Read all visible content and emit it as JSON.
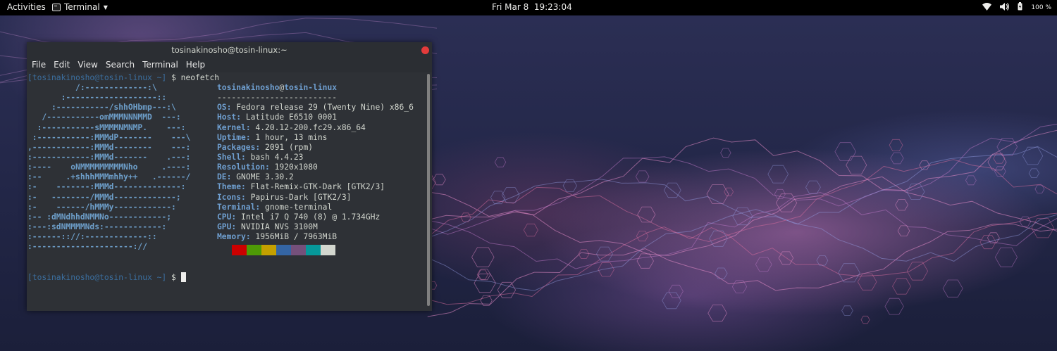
{
  "topbar": {
    "activities": "Activities",
    "app_name": "Terminal",
    "clock": "Fri Mar 8  19:23:04",
    "battery": "100 %"
  },
  "window": {
    "title": "tosinakinosho@tosin-linux:~",
    "menu": [
      "File",
      "Edit",
      "View",
      "Search",
      "Terminal",
      "Help"
    ]
  },
  "terminal": {
    "prompt": "[tosinakinosho@tosin-linux ~]",
    "command": "$ neofetch",
    "prompt2": "[tosinakinosho@tosin-linux ~]",
    "prompt2_suffix": " $ ",
    "ascii": [
      "          /:-------------:\\",
      "       :-------------------::",
      "     :-----------/shhOHbmp---:\\",
      "   /-----------omMMMNNNMMD  ---:",
      "  :-----------sMMMMNMNMP.    ---:",
      " :-----------:MMMdP-------    ---\\",
      ",------------:MMMd--------    ---:",
      ":------------:MMMd-------    .---:",
      ":----    oNMMMMMMMMMNho     .----:",
      ":--     .+shhhMMMmhhy++   .------/",
      ":-    -------:MMMd--------------:",
      ":-   --------/MMMd-------------;",
      ":-    ------/hMMMy------------:",
      ":-- :dMNdhhdNMMNo------------;",
      ":---:sdNMMMMNds:------------:",
      ":------:://:-------------::",
      ":---------------------://"
    ],
    "host_user": "tosinakinosho",
    "host_at": "@",
    "host_name": "tosin-linux",
    "separator": "-------------------------",
    "info": [
      {
        "key": "OS",
        "value": "Fedora release 29 (Twenty Nine) x86_6"
      },
      {
        "key": "Host",
        "value": "Latitude E6510 0001"
      },
      {
        "key": "Kernel",
        "value": "4.20.12-200.fc29.x86_64"
      },
      {
        "key": "Uptime",
        "value": "1 hour, 13 mins"
      },
      {
        "key": "Packages",
        "value": "2091 (rpm)"
      },
      {
        "key": "Shell",
        "value": "bash 4.4.23"
      },
      {
        "key": "Resolution",
        "value": "1920x1080"
      },
      {
        "key": "DE",
        "value": "GNOME 3.30.2"
      },
      {
        "key": "Theme",
        "value": "Flat-Remix-GTK-Dark [GTK2/3]"
      },
      {
        "key": "Icons",
        "value": "Papirus-Dark [GTK2/3]"
      },
      {
        "key": "Terminal",
        "value": "gnome-terminal"
      },
      {
        "key": "CPU",
        "value": "Intel i7 Q 740 (8) @ 1.734GHz"
      },
      {
        "key": "GPU",
        "value": "NVIDIA NVS 3100M"
      },
      {
        "key": "Memory",
        "value": "1956MiB / 7963MiB"
      }
    ],
    "palette": [
      "#2e3136",
      "#cc0000",
      "#4e9a06",
      "#c4a000",
      "#3465a4",
      "#75507b",
      "#06989a",
      "#d3d7cf"
    ]
  },
  "colors": {
    "accent": "#6f9fd0",
    "close": "#e33b3b",
    "terminal_bg": "#2e3136"
  }
}
